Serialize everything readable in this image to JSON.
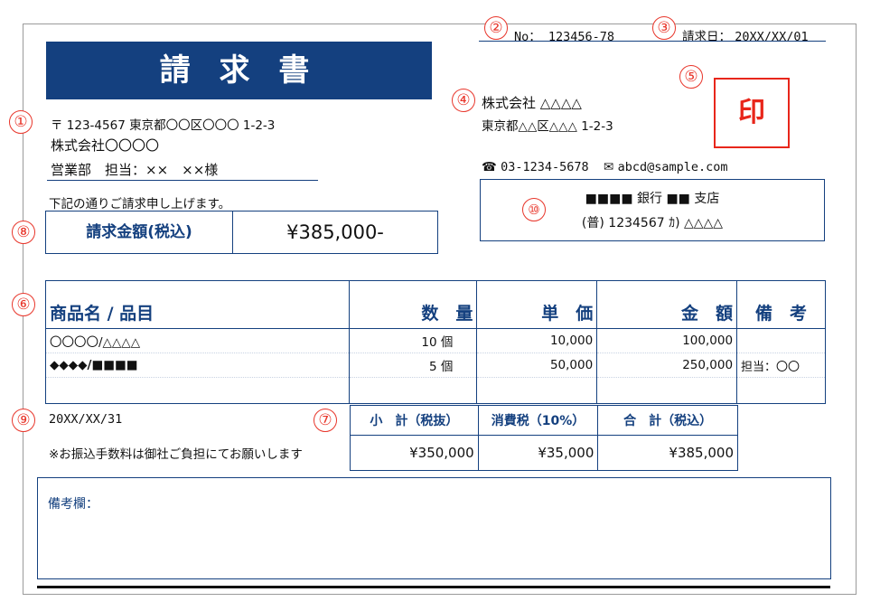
{
  "markers": [
    "①",
    "②",
    "③",
    "④",
    "⑤",
    "⑥",
    "⑦",
    "⑧",
    "⑨",
    "⑩"
  ],
  "header": {
    "title": "請 求 書",
    "no_label": "No：",
    "no_value": "123456-78",
    "date_label": "請求日：",
    "date_value": "20XX/XX/01"
  },
  "recipient": {
    "address": "〒 123-4567 東京都〇〇区〇〇〇 1-2-3",
    "company": "株式会社〇〇〇〇",
    "person": "営業部　担当：××　××様"
  },
  "intro": "下記の通りご請求申し上げます。",
  "amount": {
    "label": "請求金額(税込)",
    "value": "¥385,000-"
  },
  "issuer": {
    "company": "株式会社 △△△△",
    "address": "東京都△△区△△△ 1-2-3",
    "phone_icon": "phone-icon",
    "phone": "03-1234-5678",
    "mail_icon": "mail-icon",
    "email": "abcd@sample.com",
    "seal": "印"
  },
  "bank": {
    "line1": "■■■■ 銀行  ■■ 支店",
    "line2": "(普) 1234567 ｶ) △△△△"
  },
  "items": {
    "headers": [
      "商品名 / 品目",
      "数　量",
      "単　価",
      "金　額",
      "備　考"
    ],
    "rows": [
      [
        "〇〇〇〇/△△△△",
        "10 個",
        "10,000",
        "100,000",
        ""
      ],
      [
        "◆◆◆◆/■■■■",
        "5 個",
        "50,000",
        "250,000",
        "担当：〇〇"
      ],
      [
        "",
        "",
        "",
        "",
        ""
      ]
    ]
  },
  "due_date": "20XX/XX/31",
  "fee_note": "※お振込手数料は御社ご負担にてお願いします",
  "totals": {
    "headers": [
      "小　計（税抜）",
      "消費税（10%）",
      "合　計（税込）"
    ],
    "values": [
      "¥350,000",
      "¥35,000",
      "¥385,000"
    ]
  },
  "notes": {
    "label": "備考欄："
  },
  "colors": {
    "navy": "#14407f",
    "red": "#e8352a"
  }
}
